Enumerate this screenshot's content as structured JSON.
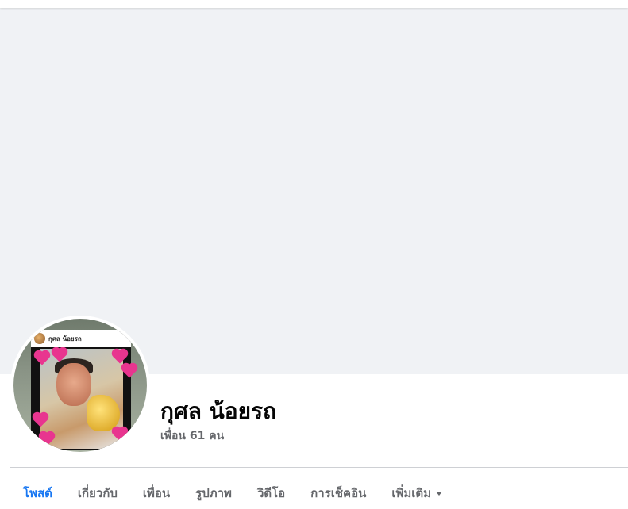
{
  "profile": {
    "name": "กุศล น้อยรถ",
    "friends_text": "เพื่อน 61 คน",
    "avatar_caption": "กุศล น้อยรถ"
  },
  "tabs": [
    {
      "label": "โพสต์",
      "active": true
    },
    {
      "label": "เกี่ยวกับ",
      "active": false
    },
    {
      "label": "เพื่อน",
      "active": false
    },
    {
      "label": "รูปภาพ",
      "active": false
    },
    {
      "label": "วิดีโอ",
      "active": false
    },
    {
      "label": "การเช็คอิน",
      "active": false
    },
    {
      "label": "เพิ่มเติม",
      "active": false,
      "icon": "caret-down-icon"
    }
  ],
  "colors": {
    "accent": "#1877f2",
    "cover": "#f0f2f5",
    "muted_text": "#65676b",
    "heart": "#e8358f"
  }
}
